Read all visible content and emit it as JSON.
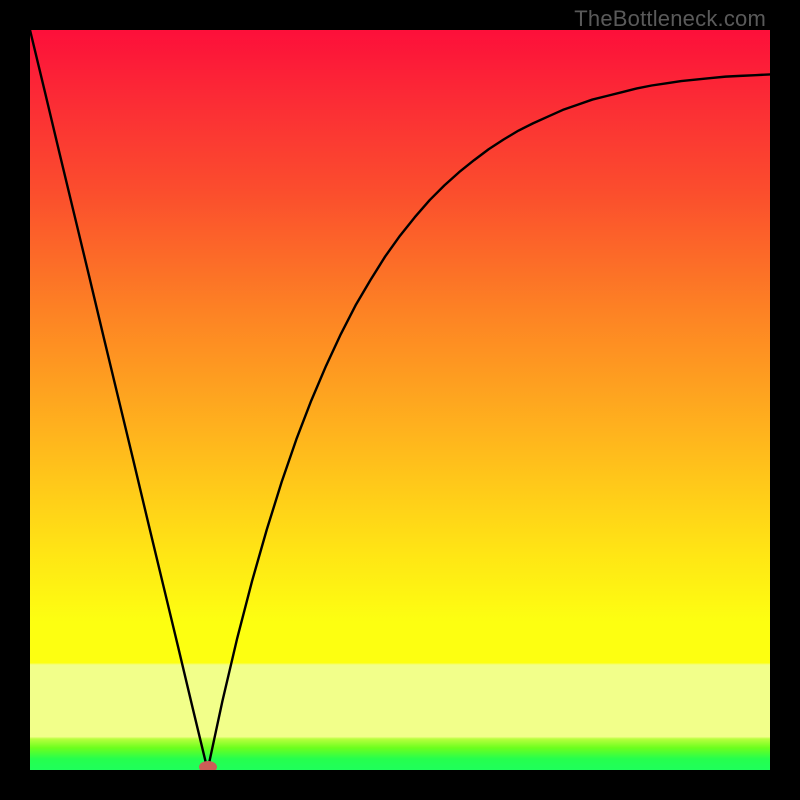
{
  "attribution": "TheBottleneck.com",
  "colors": {
    "frame": "#000000",
    "gradient_top": "#fd0f3a",
    "gradient_red": "#fb3b30",
    "gradient_orange": "#fd8b25",
    "gradient_gold": "#ffc71b",
    "gradient_yellow": "#feff14",
    "gradient_pale": "#f5ff86",
    "gradient_lime": "#86ff1e",
    "gradient_green": "#1fff5b",
    "curve": "#000000",
    "dot": "#cc5e57"
  },
  "chart_data": {
    "type": "line",
    "title": "",
    "xlabel": "",
    "ylabel": "",
    "xlim": [
      0,
      100
    ],
    "ylim": [
      0,
      100
    ],
    "legend": false,
    "annotations": [
      "TheBottleneck.com"
    ],
    "minimum": {
      "x": 24,
      "y": 0
    },
    "dot": {
      "x": 24,
      "y": 0
    },
    "x": [
      0,
      2,
      4,
      6,
      8,
      10,
      12,
      14,
      16,
      18,
      20,
      22,
      24,
      26,
      28,
      30,
      32,
      34,
      36,
      38,
      40,
      42,
      44,
      46,
      48,
      50,
      52,
      54,
      56,
      58,
      60,
      62,
      64,
      66,
      68,
      70,
      72,
      74,
      76,
      78,
      80,
      82,
      84,
      86,
      88,
      90,
      92,
      94,
      96,
      98,
      100
    ],
    "values": [
      100,
      91.7,
      83.3,
      75.0,
      66.7,
      58.3,
      50.0,
      41.7,
      33.3,
      25.0,
      16.7,
      8.3,
      0.0,
      9.3,
      17.8,
      25.5,
      32.5,
      38.9,
      44.7,
      49.9,
      54.6,
      58.9,
      62.8,
      66.2,
      69.4,
      72.2,
      74.7,
      77.0,
      79.0,
      80.8,
      82.4,
      83.9,
      85.2,
      86.4,
      87.4,
      88.3,
      89.2,
      89.9,
      90.6,
      91.1,
      91.6,
      92.1,
      92.5,
      92.8,
      93.1,
      93.3,
      93.5,
      93.7,
      93.8,
      93.9,
      94.0
    ]
  }
}
